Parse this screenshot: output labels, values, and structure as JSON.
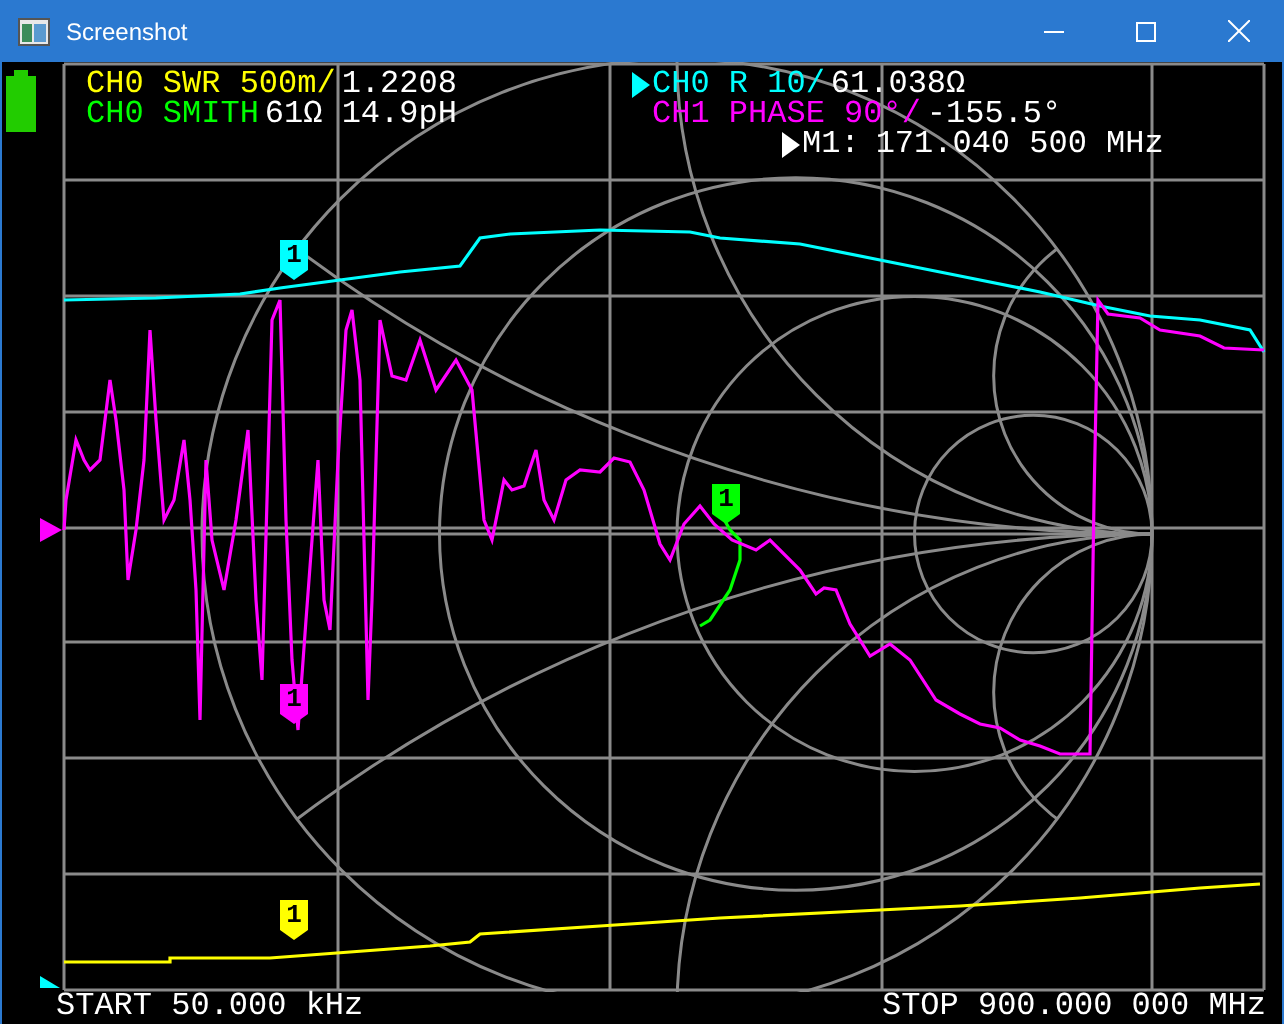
{
  "window": {
    "title": "Screenshot"
  },
  "traces": [
    {
      "label": "CH0 SWR 500m/",
      "value": "1.2208",
      "color": "#ffff00",
      "selected": false,
      "marker_label": "1"
    },
    {
      "label": "CH0 SMITH",
      "value": "61Ω 14.9pH",
      "color": "#00ff00",
      "selected": false,
      "marker_label": "1"
    },
    {
      "label": "CH0 R 10/",
      "value": "61.038Ω",
      "color": "#00ffff",
      "selected": true,
      "marker_label": "1"
    },
    {
      "label": "CH1 PHASE 90°/",
      "value": "-155.5°",
      "color": "#ff00ff",
      "selected": false,
      "marker_label": "1"
    }
  ],
  "marker": {
    "label": "M1:",
    "value": "171.040 500 MHz"
  },
  "sweep": {
    "start": "START 50.000 kHz",
    "stop": "STOP 900.000 000 MHz"
  }
}
